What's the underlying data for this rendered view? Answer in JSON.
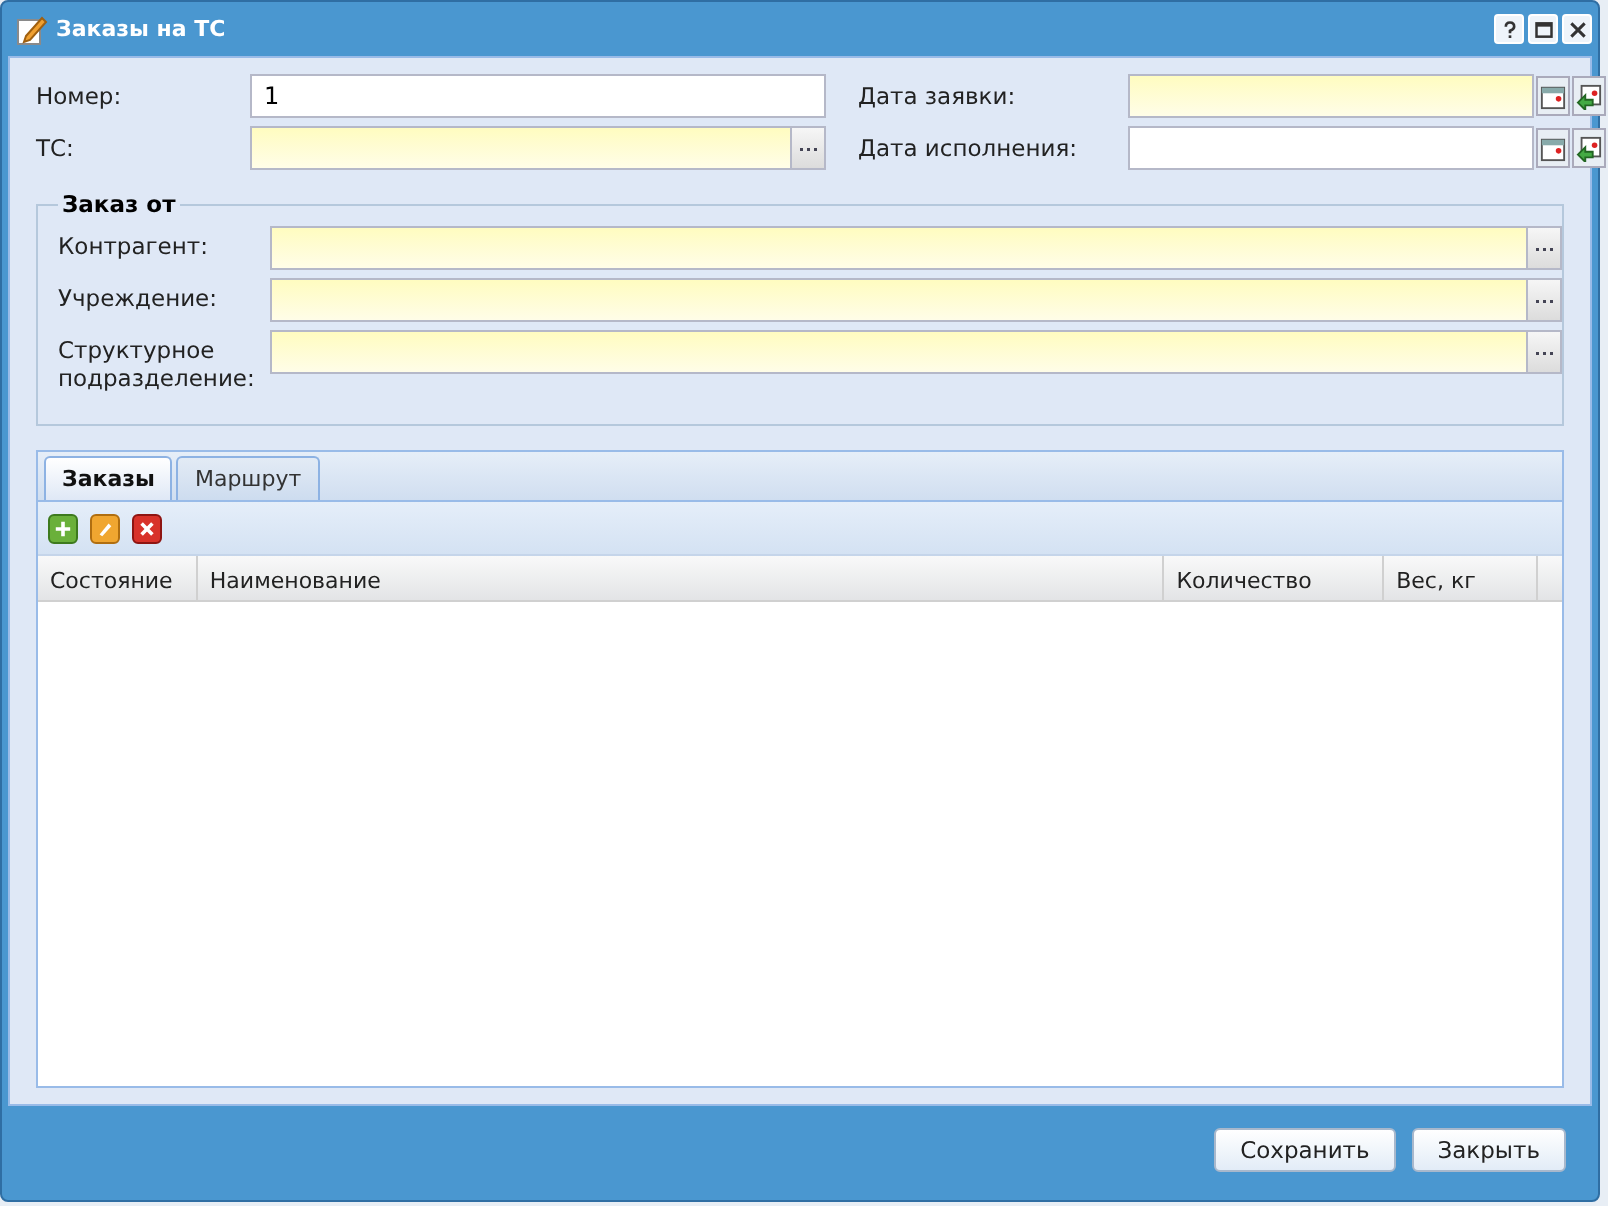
{
  "window": {
    "title": "Заказы на ТС"
  },
  "fields": [
    {
      "label": "Номер:",
      "value": "1",
      "required": false,
      "kind": "text"
    },
    {
      "label": "Дата заявки:",
      "required": true,
      "kind": "date"
    },
    {
      "label": "ТС:",
      "required": true,
      "kind": "lookup"
    },
    {
      "label": "Дата исполнения:",
      "required": false,
      "kind": "date"
    }
  ],
  "fieldset": {
    "title": "Заказ от",
    "fields": [
      {
        "label": "Контрагент:",
        "required": true,
        "kind": "lookup"
      },
      {
        "label": "Учреждение:",
        "required": true,
        "kind": "lookup"
      },
      {
        "label": "Структурное подразделение:",
        "required": true,
        "kind": "lookup"
      }
    ]
  },
  "tabs": [
    {
      "label": "Заказы",
      "selected": true
    },
    {
      "label": "Маршрут",
      "selected": false
    }
  ],
  "table": {
    "columns": [
      "Состояние",
      "Наименование",
      "Количество",
      "Вес, кг"
    ]
  },
  "buttons": [
    "Сохранить",
    "Закрыть"
  ]
}
